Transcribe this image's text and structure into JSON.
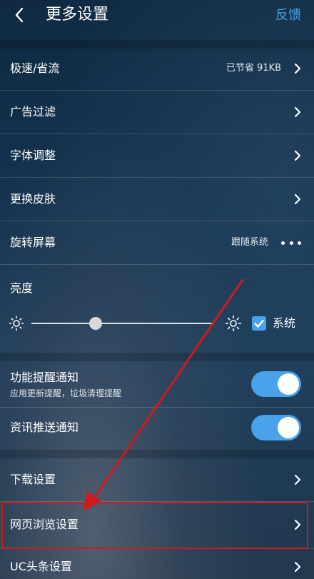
{
  "header": {
    "title": "更多设置",
    "feedback_label": "反馈",
    "back_icon": "chevron-left-icon"
  },
  "settings": {
    "speed_saving": {
      "label": "极速/省流",
      "value": "已节省 91KB"
    },
    "ad_filter": {
      "label": "广告过滤"
    },
    "font_adjust": {
      "label": "字体调整"
    },
    "change_skin": {
      "label": "更换皮肤"
    },
    "rotate_screen": {
      "label": "旋转屏幕",
      "value": "跟随系统"
    },
    "brightness": {
      "label": "亮度",
      "level": 0.35,
      "follow_system_label": "系统",
      "follow_system_checked": true
    },
    "function_reminder": {
      "label": "功能提醒通知",
      "sublabel": "应用更新提醒，垃圾清理提醒",
      "enabled": true
    },
    "news_push": {
      "label": "资讯推送通知",
      "enabled": true
    },
    "download_settings": {
      "label": "下载设置"
    },
    "web_browsing_settings": {
      "label": "网页浏览设置"
    },
    "uc_headline_settings": {
      "label": "UC头条设置"
    }
  },
  "colors": {
    "accent": "#4aa3ea",
    "annotation_red": "#d11a1a"
  }
}
